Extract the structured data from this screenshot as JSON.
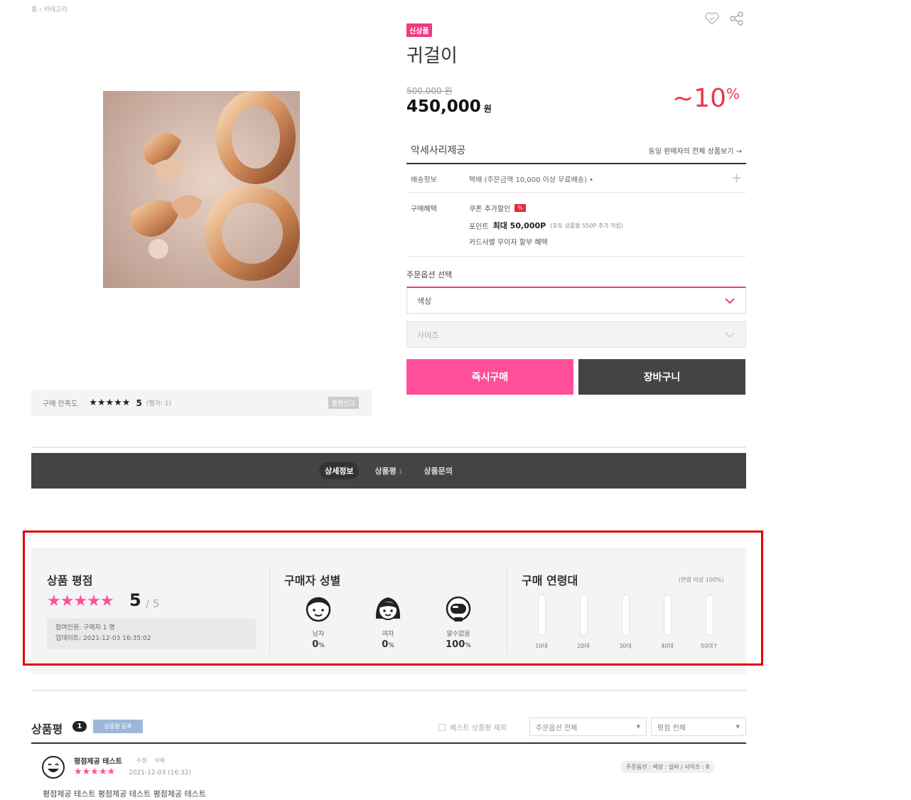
{
  "breadcrumb": "홈 › 카테고리",
  "product": {
    "badge": "신상품",
    "title": "귀걸이",
    "original_price": "500,000 원",
    "price": "450,000",
    "currency": "원",
    "discount_prefix": "~",
    "discount_value": "10",
    "discount_unit": "%"
  },
  "seller": {
    "name": "악세사리제공",
    "link": "동일 판매자의 전체 상품보기 →"
  },
  "shipping": {
    "label": "배송정보",
    "text": "택배 (주문금액 10,000 이상 무료배송) •",
    "plus": "+"
  },
  "benefits": {
    "label": "구매혜택",
    "coupon_text": "쿠폰 추가할인",
    "coupon_badge": "%",
    "point_label": "포인트",
    "point_max": "최대 50,000P",
    "point_note": "(포토 상품평 550P 추가 적립)",
    "card_text": "카드사별 무이자 할부 혜택"
  },
  "options": {
    "label": "주문옵션 선택",
    "color_placeholder": "색상",
    "size_placeholder": "사이즈"
  },
  "buttons": {
    "buy": "즉시구매",
    "cart": "장바구니"
  },
  "satisfaction": {
    "label": "구매 만족도",
    "stars": "★★★★★",
    "score": "5",
    "count": "(평가: 1)",
    "report": "불편신고"
  },
  "tabs": [
    {
      "label": "상세정보",
      "count": ""
    },
    {
      "label": "상품평",
      "count": "1"
    },
    {
      "label": "상품문의",
      "count": ""
    }
  ],
  "stats": {
    "rating_title": "상품 평점",
    "rating_stars": "★★★★★",
    "rating_score": "5",
    "rating_max": "/ 5",
    "participants": "참여인원: 구매자 1 명",
    "updated": "업데이트: 2021-12-03 16:35:02",
    "gender_title": "구매자 성별",
    "genders": [
      {
        "label": "남자",
        "value": "0",
        "unit": "%"
      },
      {
        "label": "여자",
        "value": "0",
        "unit": "%"
      },
      {
        "label": "알수없음",
        "value": "100",
        "unit": "%"
      }
    ],
    "age_title": "구매 연령대",
    "age_note": "(연령 미상 100%)",
    "ages": [
      "10대",
      "20대",
      "30대",
      "40대",
      "50대↑"
    ]
  },
  "reviews": {
    "title": "상품평",
    "count": "1",
    "write_button": "상품평 등록",
    "best_exclude": "베스트 상품평 제외",
    "filter_option": "주문옵션 전체",
    "filter_rating": "평점 전체",
    "items": [
      {
        "name": "평점제공 테스트",
        "edit": "수정",
        "delete": "삭제",
        "stars": "★★★★★",
        "date": "2021-12-03 (16:32)",
        "option": "주문옵션 : 색상 : 실버 / 사이즈 : 8",
        "text": "평점제공 테스트 평점제공 테스트 평점제공 테스트"
      }
    ]
  },
  "colors": {
    "accent_pink": "#ff4f9b",
    "badge_pink": "#ee3c82",
    "discount_red": "#e8394a",
    "dark": "#444444",
    "highlight_red": "#e00000"
  }
}
